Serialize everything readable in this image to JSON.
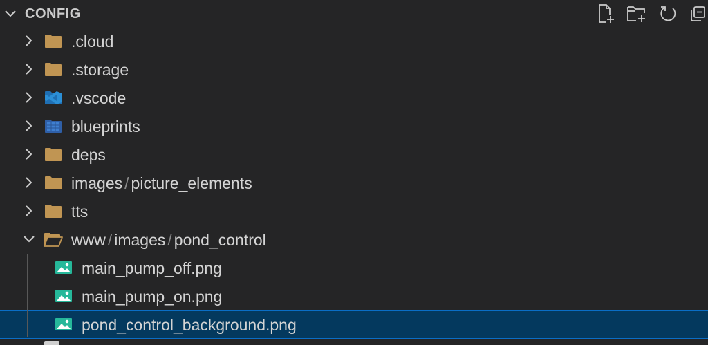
{
  "explorer": {
    "section_title": "CONFIG",
    "actions": [
      {
        "name": "new-file",
        "icon": "new-file-icon"
      },
      {
        "name": "new-folder",
        "icon": "new-folder-icon"
      },
      {
        "name": "refresh",
        "icon": "refresh-icon"
      },
      {
        "name": "collapse-all",
        "icon": "collapse-all-icon"
      }
    ],
    "items": [
      {
        "label": ".cloud",
        "type": "folder",
        "expanded": false,
        "icon": "folder-icon"
      },
      {
        "label": ".storage",
        "type": "folder",
        "expanded": false,
        "icon": "folder-icon"
      },
      {
        "label": ".vscode",
        "type": "folder",
        "expanded": false,
        "icon": "vscode-folder-icon"
      },
      {
        "label": "blueprints",
        "type": "folder",
        "expanded": false,
        "icon": "blueprint-folder-icon"
      },
      {
        "label": "deps",
        "type": "folder",
        "expanded": false,
        "icon": "folder-icon"
      },
      {
        "label_parts": [
          "images",
          "picture_elements"
        ],
        "type": "folder",
        "expanded": false,
        "icon": "folder-icon"
      },
      {
        "label": "tts",
        "type": "folder",
        "expanded": false,
        "icon": "folder-icon"
      },
      {
        "label_parts": [
          "www",
          "images",
          "pond_control"
        ],
        "type": "folder",
        "expanded": true,
        "icon": "folder-open-icon"
      },
      {
        "label": "main_pump_off.png",
        "type": "file",
        "icon": "image-file-icon"
      },
      {
        "label": "main_pump_on.png",
        "type": "file",
        "icon": "image-file-icon"
      },
      {
        "label": "pond_control_background.png",
        "type": "file",
        "icon": "image-file-icon",
        "selected": true
      }
    ],
    "separator": "/",
    "colors": {
      "background": "#252526",
      "selection": "#04395e",
      "selection_border": "#0a6ec6",
      "folder": "#c09553",
      "vscode_blue": "#2b8fd6",
      "image_icon": "#26b89a",
      "text": "#d4d4d4"
    }
  }
}
